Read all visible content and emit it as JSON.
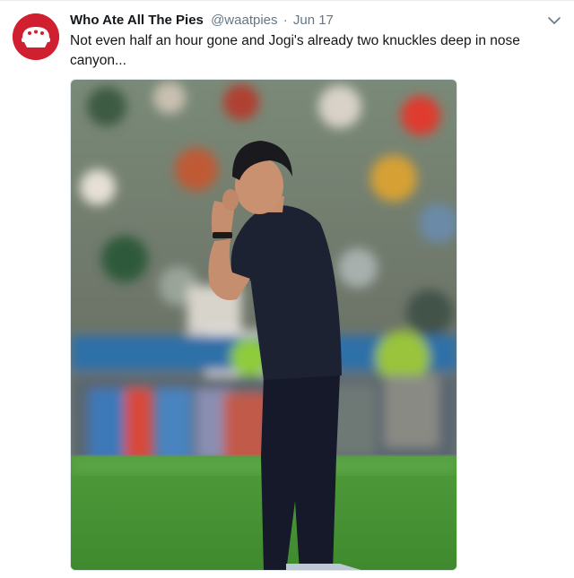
{
  "tweet": {
    "author_name": "Who Ate All The Pies",
    "handle": "@waatpies",
    "separator": "·",
    "date": "Jun 17",
    "text": "Not even half an hour gone and Jogi's already two knuckles deep in nose canyon..."
  },
  "icons": {
    "avatar": "pie-logo-icon",
    "menu": "chevron-down-icon"
  },
  "colors": {
    "avatar_bg": "#d0202f",
    "name": "#14171a",
    "secondary": "#657786",
    "border": "#e1e8ed"
  }
}
